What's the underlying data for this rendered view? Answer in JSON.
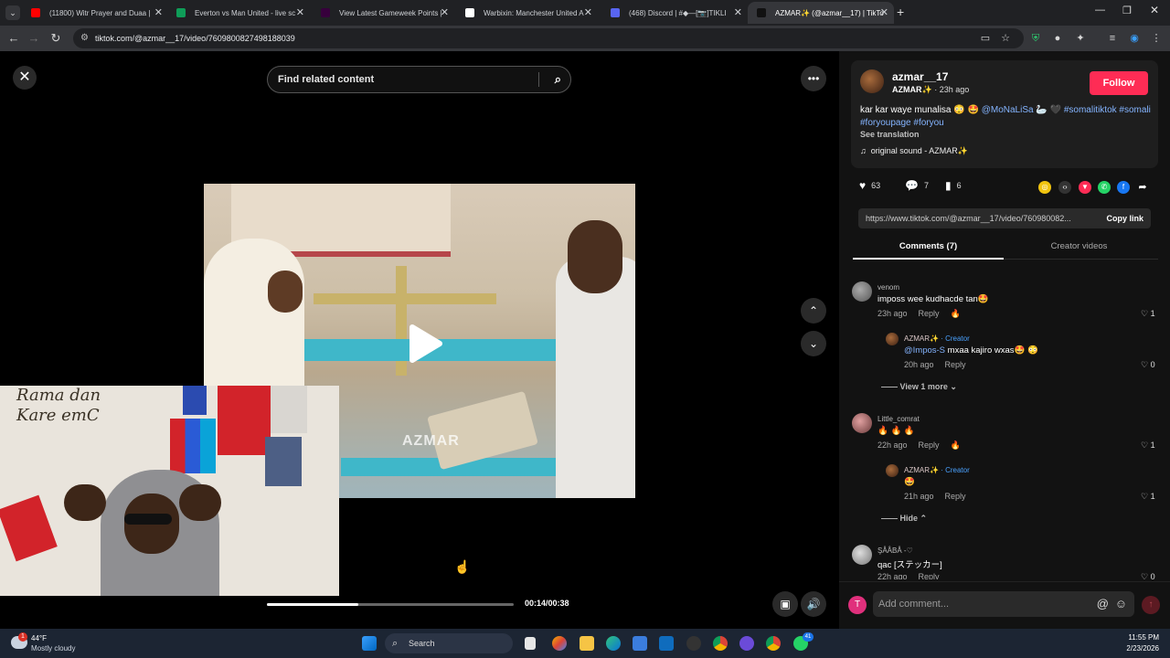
{
  "browser": {
    "tabs": [
      {
        "title": "(11800) Witr Prayer and Duaa |",
        "color": "#ff0000",
        "active": false
      },
      {
        "title": "Everton vs Man United - live sc",
        "color": "#0f9d58",
        "active": false
      },
      {
        "title": "View Latest Gameweek Points |",
        "color": "#37003c",
        "active": false
      },
      {
        "title": "Warbixin: Manchester United A",
        "color": "#ffffff",
        "active": false
      },
      {
        "title": "(468) Discord | #◆—[📷]TIKLI",
        "color": "#5865f2",
        "active": false
      },
      {
        "title": "AZMAR✨ (@azmar__17) | TikTo",
        "color": "#111111",
        "active": true
      }
    ],
    "url": "tiktok.com/@azmar__17/video/7609800827498188039"
  },
  "video": {
    "search_placeholder": "Find related content",
    "watermark": "AZMAR",
    "progress": 0.37,
    "time": "00:14/00:38"
  },
  "webcam": {
    "wall_text_1": "Rama dan",
    "wall_text_2": "Kare emC"
  },
  "post": {
    "username": "azmar__17",
    "nickname": "AZMAR✨",
    "posted": "23h ago",
    "follow_label": "Follow",
    "caption_text": "kar kar waye munalisa 😳 🤩 ",
    "caption_mention": "@MoNaLiSa",
    "caption_mid": " 🦢 🖤 ",
    "caption_tags": "#somalitiktok #somali #foryoupage #foryou",
    "see_translation": "See translation",
    "sound": "original sound - AZMAR✨",
    "likes": "63",
    "comments_count": "7",
    "saves": "6",
    "link": "https://www.tiktok.com/@azmar__17/video/760980082...",
    "copy_link": "Copy link",
    "tab_comments": "Comments (7)",
    "tab_creator": "Creator videos"
  },
  "comments": [
    {
      "name": "venom",
      "text": "imposs wee kudhacde tan🤩",
      "time": "23h ago",
      "reply": "Reply",
      "likes": "1"
    },
    {
      "name": "AZMAR✨",
      "tag": "· Creator",
      "mention": "@Impos-S",
      "text": " mxaa kajiro wxas🤩 😳",
      "time": "20h ago",
      "reply": "Reply",
      "likes": "0"
    },
    {
      "viewmore": "View 1 more"
    },
    {
      "name": "Little_comrat",
      "text": "🔥 🔥 🔥",
      "time": "22h ago",
      "reply": "Reply",
      "likes": "1"
    },
    {
      "name": "AZMAR✨",
      "tag": "· Creator",
      "text": "🤩",
      "time": "21h ago",
      "reply": "Reply",
      "likes": "1"
    },
    {
      "hide": "Hide"
    },
    {
      "name": "ŞÅÅBÅ -♡",
      "text": "qac [ステッカー]",
      "time": "22h ago",
      "reply": "Reply",
      "likes": "0"
    }
  ],
  "composer": {
    "avatar_letter": "T",
    "placeholder": "Add comment..."
  },
  "taskbar": {
    "temp": "44°F",
    "weather": "Mostly cloudy",
    "search": "Search",
    "time": "11:55 PM",
    "date": "2/23/2026",
    "whatsapp_badge": "41",
    "weather_badge": "1"
  }
}
